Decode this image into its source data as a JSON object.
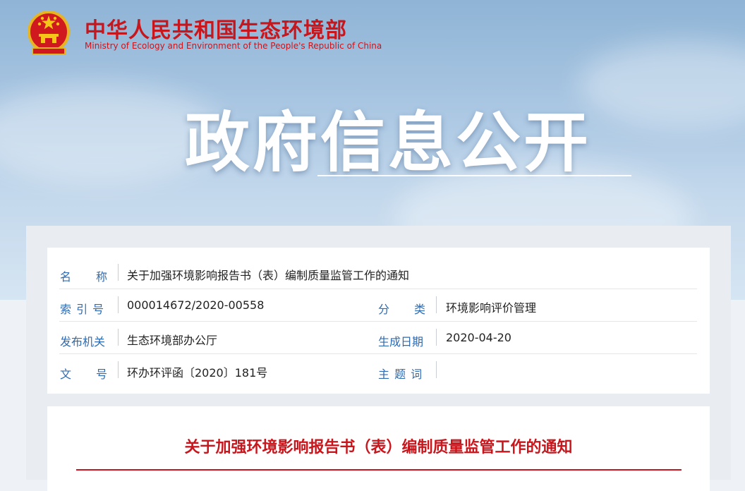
{
  "header": {
    "site_name_cn": "中华人民共和国生态环境部",
    "site_name_en": "Ministry of Ecology and Environment of the People's Republic of China",
    "banner_title": "政府信息公开"
  },
  "metadata": {
    "name_label": "名　　称",
    "name_value": "关于加强环境影响报告书（表）编制质量监管工作的通知",
    "index_label": "索 引 号",
    "index_value": "000014672/2020-00558",
    "category_label": "分　　类",
    "category_value": "环境影响评价管理",
    "issuer_label": "发布机关",
    "issuer_value": "生态环境部办公厅",
    "date_label": "生成日期",
    "date_value": "2020-04-20",
    "docno_label": "文　　号",
    "docno_value": "环办环评函〔2020〕181号",
    "keywords_label": "主 题 词",
    "keywords_value": ""
  },
  "document": {
    "title": "关于加强环境影响报告书（表）编制质量监管工作的通知"
  },
  "colors": {
    "brand_red": "#c8161d",
    "label_blue": "#2f6bb0"
  }
}
